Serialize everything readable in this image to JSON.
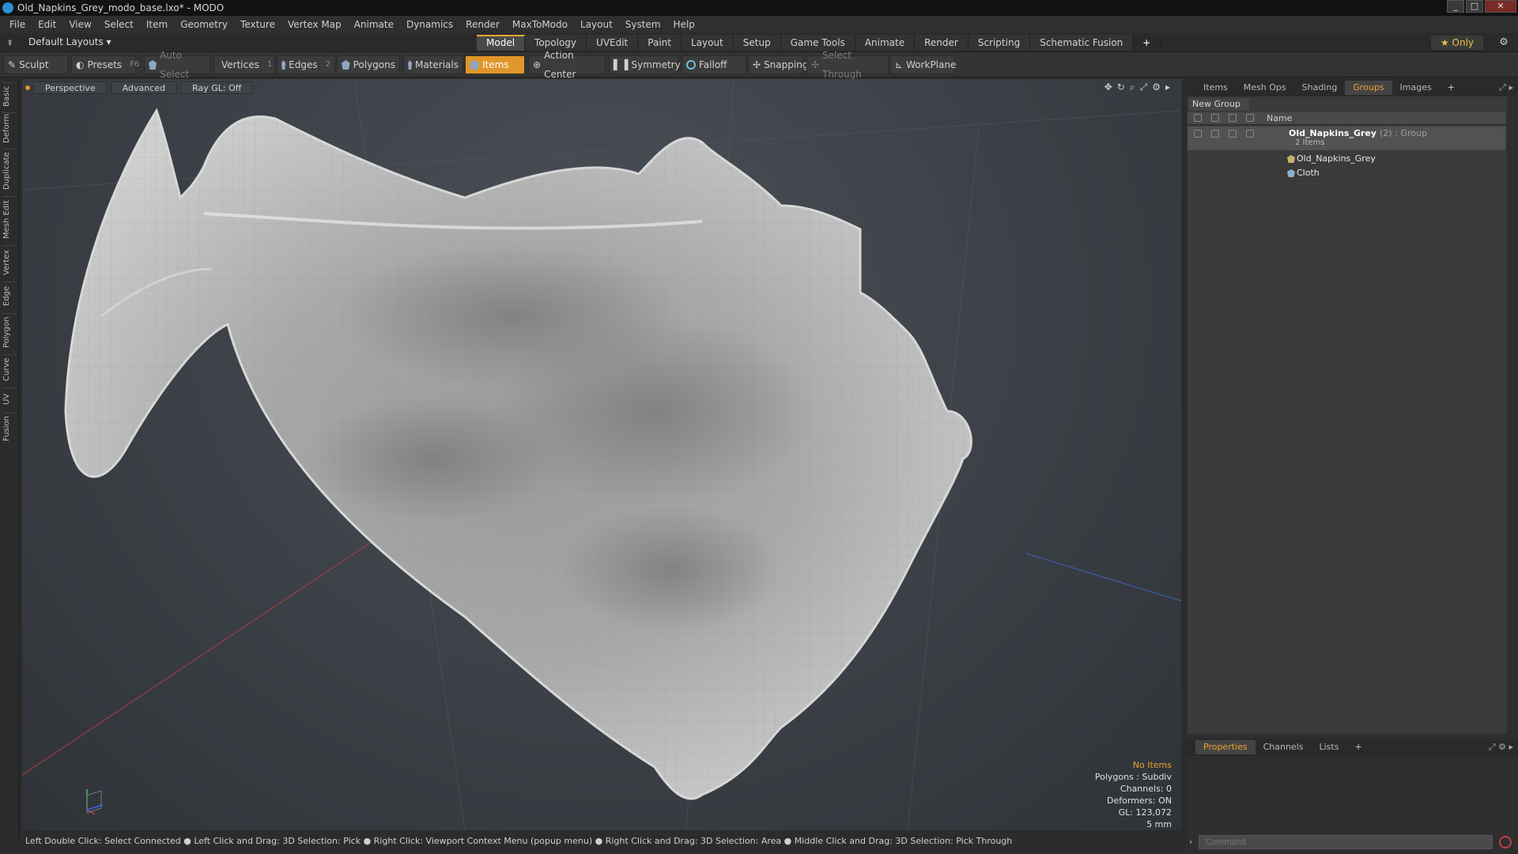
{
  "window": {
    "title": "Old_Napkins_Grey_modo_base.lxo* - MODO",
    "buttons": [
      "_",
      "□",
      "✕"
    ]
  },
  "menu": [
    "File",
    "Edit",
    "View",
    "Select",
    "Item",
    "Geometry",
    "Texture",
    "Vertex Map",
    "Animate",
    "Dynamics",
    "Render",
    "MaxToModo",
    "Layout",
    "System",
    "Help"
  ],
  "layout": {
    "selector": "Default Layouts ▾",
    "tabs": [
      "Model",
      "Topology",
      "UVEdit",
      "Paint",
      "Layout",
      "Setup",
      "Game Tools",
      "Animate",
      "Render",
      "Scripting",
      "Schematic Fusion",
      "+"
    ],
    "active_tab": "Model",
    "only_label": "★  Only"
  },
  "toolbar": {
    "sculpt": "Sculpt",
    "presets": "Presets",
    "presets_key": "F6",
    "auto_select": "Auto Select",
    "vertices": "Vertices",
    "vertices_num": "1",
    "edges": "Edges",
    "edges_num": "2",
    "polygons": "Polygons",
    "materials": "Materials",
    "items": "Items",
    "action_center": "Action Center",
    "symmetry": "Symmetry",
    "falloff": "Falloff",
    "snapping": "Snapping",
    "select_through": "Select Through",
    "workplane": "WorkPlane"
  },
  "left_tabs": [
    "Basic",
    "Deform",
    "Duplicate",
    "Mesh Edit",
    "Vertex",
    "Edge",
    "Polygon",
    "Curve",
    "UV",
    "Fusion"
  ],
  "viewport": {
    "view": "Perspective",
    "shading": "Advanced",
    "raygl": "Ray GL: Off",
    "info": {
      "selection": "No Items",
      "polygons": "Polygons : Subdiv",
      "channels": "Channels: 0",
      "deformers": "Deformers: ON",
      "gl": "GL: 123,072",
      "scale": "5 mm"
    }
  },
  "status": "Left Double Click: Select Connected ● Left Click and Drag: 3D Selection: Pick ● Right Click: Viewport Context Menu (popup menu) ● Right Click and Drag: 3D Selection: Area ● Middle Click and Drag: 3D Selection: Pick Through",
  "panel_top": {
    "tabs": [
      "Items",
      "Mesh Ops",
      "Shading",
      "Groups",
      "Images",
      "+"
    ],
    "active": "Groups",
    "new_group": "New Group",
    "column_name": "Name",
    "group": {
      "name": "Old_Napkins_Grey",
      "count": "(2)",
      "type": ": Group",
      "sub": "2 Items"
    },
    "children": [
      "Old_Napkins_Grey",
      "Cloth"
    ]
  },
  "panel_bottom": {
    "tabs": [
      "Properties",
      "Channels",
      "Lists",
      "+"
    ],
    "active": "Properties",
    "command_placeholder": "Command"
  },
  "colors": {
    "accent": "#e0962a",
    "viewport_bg": "#3b4046",
    "panel_bg": "#2e2e2e"
  }
}
